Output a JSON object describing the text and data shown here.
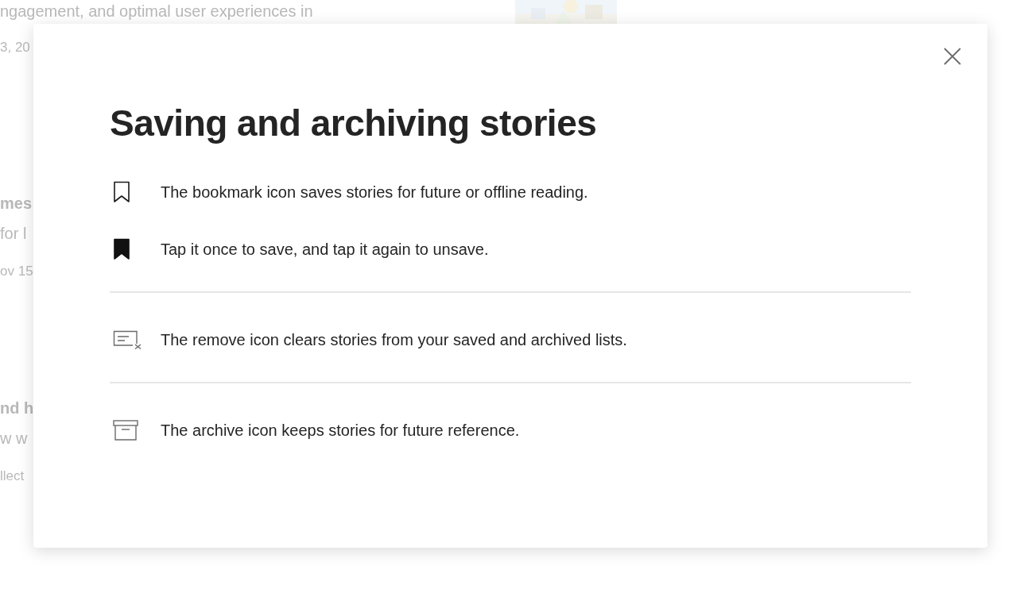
{
  "background_stories": [
    {
      "subtitle": "ngagement, and optimal user experiences in",
      "meta": "3, 20"
    },
    {
      "title": "mes",
      "subtitle": "for l",
      "meta": "ov 15"
    },
    {
      "title": "nd h",
      "subtitle": "w w",
      "meta": "llect"
    }
  ],
  "dialog": {
    "title": "Saving and archiving stories",
    "sections": [
      {
        "items": [
          {
            "kind": "bookmark",
            "text": "The bookmark icon saves stories for future or offline reading."
          },
          {
            "kind": "bookmark_filled",
            "text": "Tap it once to save, and tap it again to unsave."
          }
        ]
      },
      {
        "items": [
          {
            "kind": "remove",
            "text": "The remove icon clears stories from your saved and archived lists."
          }
        ]
      },
      {
        "items": [
          {
            "kind": "archive",
            "text": "The archive icon keeps stories for future reference."
          }
        ]
      }
    ]
  }
}
